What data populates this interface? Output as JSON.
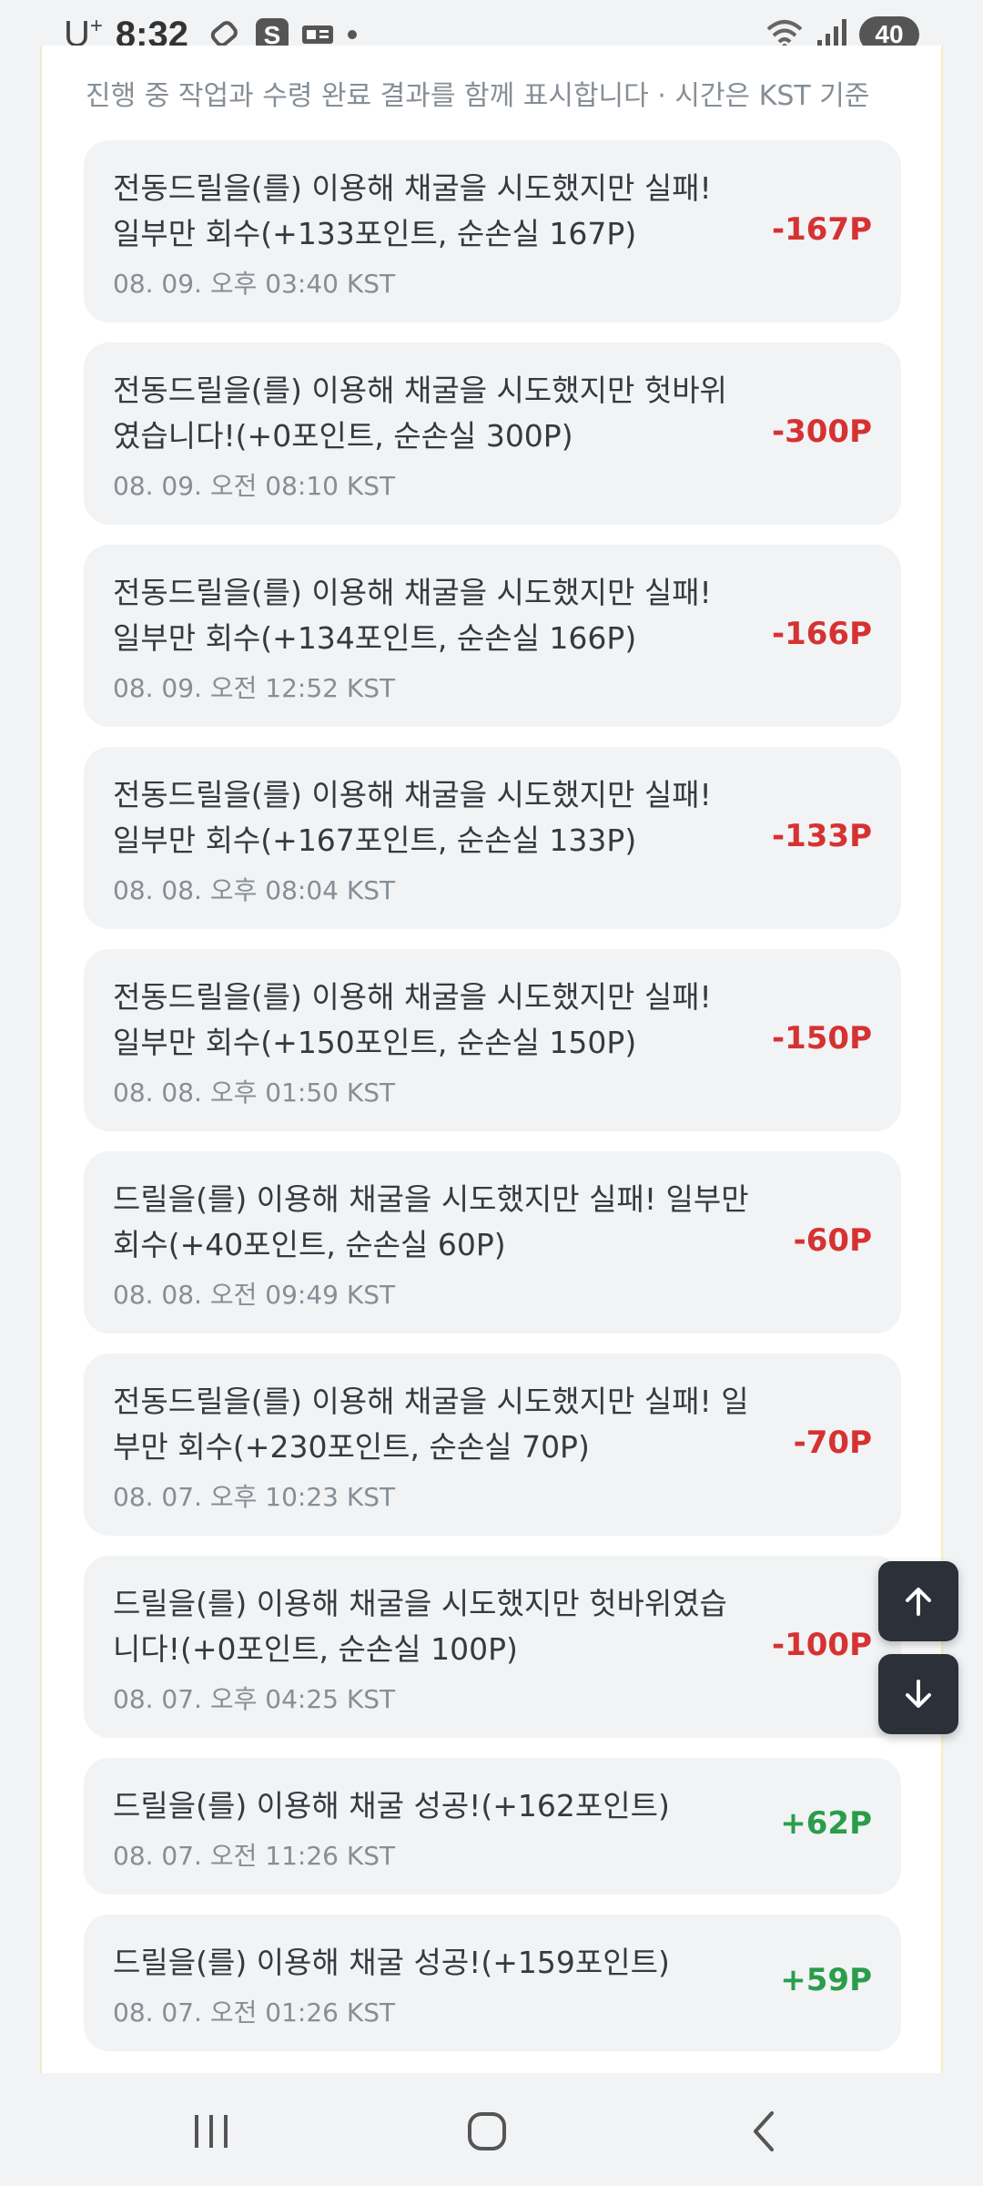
{
  "status_bar": {
    "carrier": "U",
    "carrier_sup": "+",
    "time": "8:32",
    "battery": "40"
  },
  "panel": {
    "subtitle": "진행 중 작업과 수령 완료 결과를 함께 표시합니다 · 시간은 KST 기준"
  },
  "items": [
    {
      "line1": "전동드릴을(를) 이용해 채굴을 시도했지만 실패!",
      "line2": "일부만 회수(+133포인트, 순손실 167P)",
      "time": "08. 09. 오후 03:40 KST",
      "amount": "-167P",
      "type": "loss"
    },
    {
      "line1": "전동드릴을(를) 이용해 채굴을 시도했지만 헛바위",
      "line2": "였습니다!(+0포인트, 순손실 300P)",
      "time": "08. 09. 오전 08:10 KST",
      "amount": "-300P",
      "type": "loss"
    },
    {
      "line1": "전동드릴을(를) 이용해 채굴을 시도했지만 실패!",
      "line2": "일부만 회수(+134포인트, 순손실 166P)",
      "time": "08. 09. 오전 12:52 KST",
      "amount": "-166P",
      "type": "loss"
    },
    {
      "line1": "전동드릴을(를) 이용해 채굴을 시도했지만 실패!",
      "line2": "일부만 회수(+167포인트, 순손실 133P)",
      "time": "08. 08. 오후 08:04 KST",
      "amount": "-133P",
      "type": "loss"
    },
    {
      "line1": "전동드릴을(를) 이용해 채굴을 시도했지만 실패!",
      "line2": "일부만 회수(+150포인트, 순손실 150P)",
      "time": "08. 08. 오후 01:50 KST",
      "amount": "-150P",
      "type": "loss"
    },
    {
      "line1": "드릴을(를) 이용해 채굴을 시도했지만 실패! 일부만",
      "line2": "회수(+40포인트, 순손실 60P)",
      "time": "08. 08. 오전 09:49 KST",
      "amount": "-60P",
      "type": "loss"
    },
    {
      "line1": "전동드릴을(를) 이용해 채굴을 시도했지만 실패! 일",
      "line2": "부만 회수(+230포인트, 순손실 70P)",
      "time": "08. 07. 오후 10:23 KST",
      "amount": "-70P",
      "type": "loss"
    },
    {
      "line1": "드릴을(를) 이용해 채굴을 시도했지만 헛바위였습",
      "line2": "니다!(+0포인트, 순손실 100P)",
      "time": "08. 07. 오후 04:25 KST",
      "amount": "-100P",
      "type": "loss"
    },
    {
      "line1": "드릴을(를) 이용해 채굴 성공!(+162포인트)",
      "line2": "",
      "time": "08. 07. 오전 11:26 KST",
      "amount": "+62P",
      "type": "gain"
    },
    {
      "line1": "드릴을(를) 이용해 채굴 성공!(+159포인트)",
      "line2": "",
      "time": "08. 07. 오전 01:26 KST",
      "amount": "+59P",
      "type": "gain"
    }
  ],
  "icons": {
    "scroll_up": "arrow-up-icon",
    "scroll_down": "arrow-down-icon",
    "nav_recent": "recent-apps-icon",
    "nav_home": "home-icon",
    "nav_back": "back-icon"
  }
}
